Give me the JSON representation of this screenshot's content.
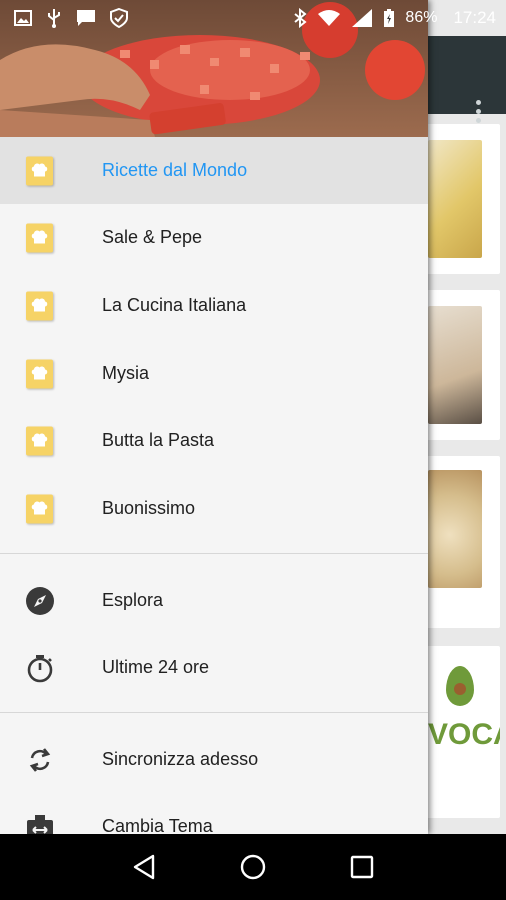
{
  "status_bar": {
    "battery": "86%",
    "time": "17:24",
    "icons": [
      "image-icon",
      "usb-icon",
      "message-icon",
      "shield-icon",
      "bluetooth-icon",
      "wifi-icon",
      "signal-icon",
      "battery-charging-icon"
    ]
  },
  "drawer": {
    "feeds": [
      {
        "label": "Ricette dal Mondo",
        "active": true
      },
      {
        "label": "Sale & Pepe",
        "active": false
      },
      {
        "label": "La Cucina Italiana",
        "active": false
      },
      {
        "label": "Mysia",
        "active": false
      },
      {
        "label": "Butta la Pasta",
        "active": false
      },
      {
        "label": "Buonissimo",
        "active": false
      }
    ],
    "menu": [
      {
        "label": "Esplora",
        "icon": "compass-icon"
      },
      {
        "label": "Ultime 24 ore",
        "icon": "stopwatch-icon"
      }
    ],
    "settings": [
      {
        "label": "Sincronizza adesso",
        "icon": "sync-icon"
      },
      {
        "label": "Cambia Tema",
        "icon": "theme-icon"
      }
    ]
  },
  "colors": {
    "active_text": "#2196f3",
    "feed_icon": "#f6d366",
    "toolbar": "#2c3639"
  },
  "background_card_text": "VOCA"
}
